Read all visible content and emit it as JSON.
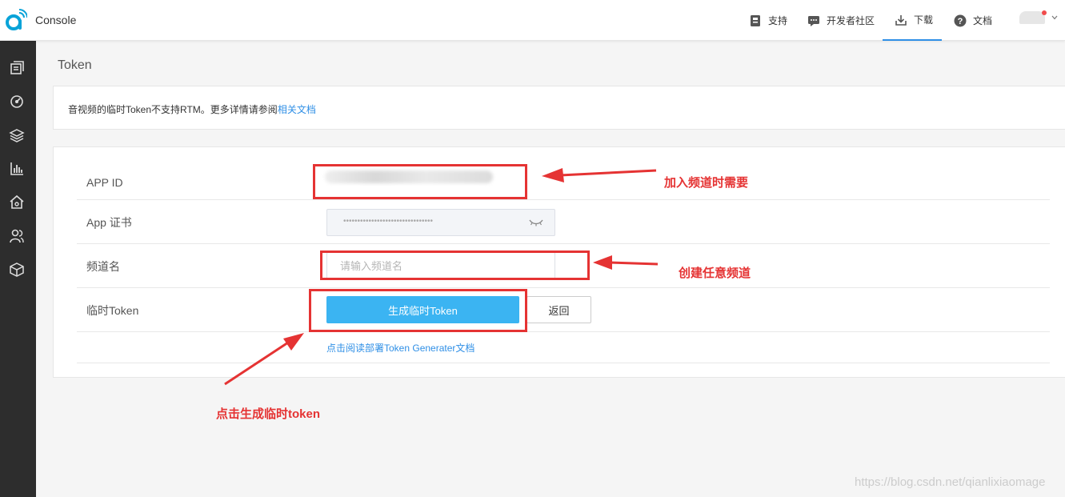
{
  "header": {
    "brand": "Console",
    "nav": [
      {
        "label": "支持",
        "icon": "support-icon"
      },
      {
        "label": "开发者社区",
        "icon": "community-icon"
      },
      {
        "label": "下载",
        "icon": "download-icon"
      },
      {
        "label": "文档",
        "icon": "help-icon"
      }
    ],
    "active_nav": "下载"
  },
  "sidebar": {
    "icons": [
      "overview-icon",
      "dashboard-icon",
      "layers-icon",
      "analytics-icon",
      "home-settings-icon",
      "users-icon",
      "cube-icon"
    ]
  },
  "page": {
    "title": "Token",
    "notice_text": "音视频的临时Token不支持RTM。更多详情请参阅",
    "notice_link": "相关文档"
  },
  "form": {
    "app_id_label": "APP ID",
    "cert_label": "App 证书",
    "cert_value": "••••••••••••••••••••••••••••••••",
    "channel_label": "频道名",
    "channel_placeholder": "请输入频道名",
    "token_label": "临时Token",
    "generate_button": "生成临时Token",
    "back_button": "返回",
    "doc_link": "点击阅读部署Token Generater文档"
  },
  "annotations": {
    "app_id_note": "加入频道时需要",
    "channel_note": "创建任意频道",
    "token_note": "点击生成临时token"
  },
  "watermark": "https://blog.csdn.net/qianlixiaomage",
  "colors": {
    "accent": "#2f8fe6",
    "button": "#3bb4f2",
    "annotation": "#e53333",
    "sidebar": "#2d2d2d"
  }
}
